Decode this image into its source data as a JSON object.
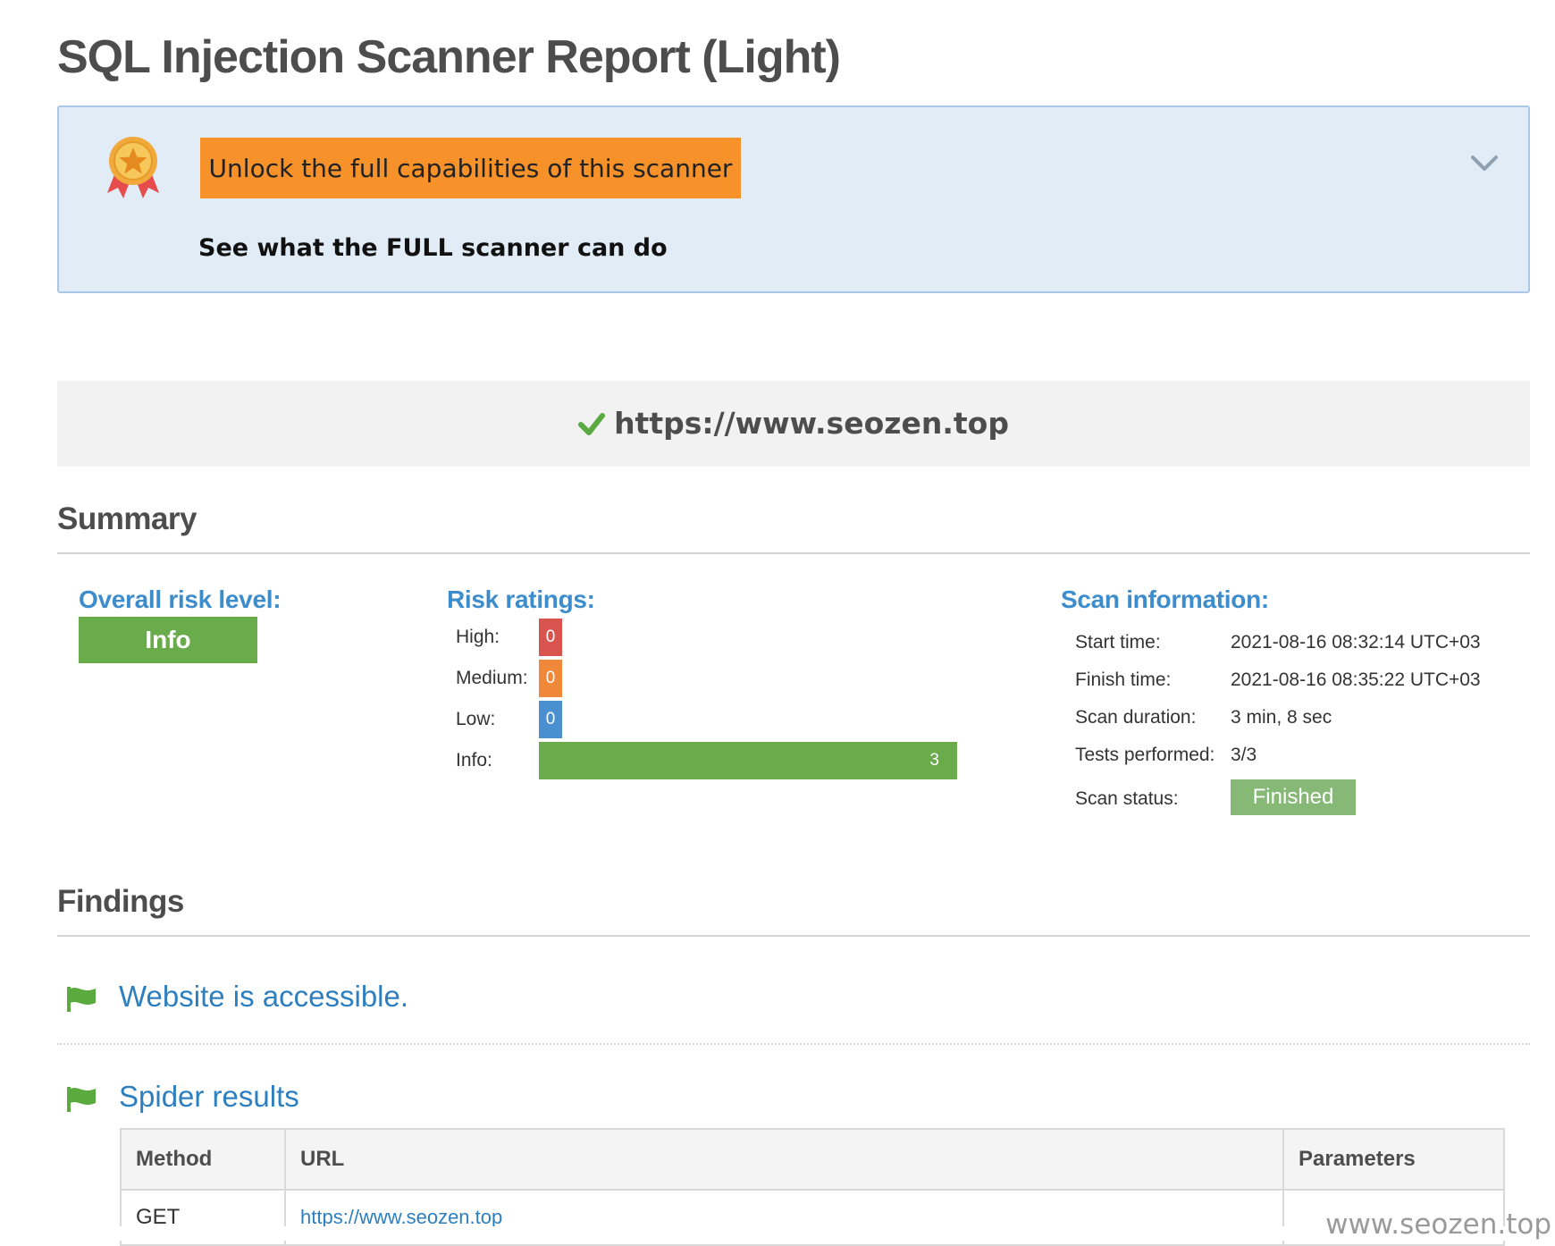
{
  "header": {
    "title": "SQL Injection Scanner Report (Light)"
  },
  "promo": {
    "medal_icon": "medal-icon",
    "button_label": "Unlock the full capabilities of this scanner",
    "subtitle": "See what the FULL scanner can do",
    "toggle_icon": "chevron-down-icon",
    "colors": {
      "background": "#e1ecf6",
      "button": "#f7922a"
    }
  },
  "target": {
    "status_icon": "checkmark-icon",
    "url": "https://www.seozen.top"
  },
  "summary": {
    "title": "Summary",
    "overall_risk": {
      "label": "Overall risk level:",
      "value": "Info",
      "color": "#6aab4c"
    },
    "risk_ratings": {
      "label": "Risk ratings:",
      "items": [
        {
          "name": "High:",
          "count": "0",
          "color": "#d9534f"
        },
        {
          "name": "Medium:",
          "count": "0",
          "color": "#f0883a"
        },
        {
          "name": "Low:",
          "count": "0",
          "color": "#4a8fd0"
        },
        {
          "name": "Info:",
          "count": "3",
          "color": "#6aab4c"
        }
      ]
    },
    "scan_info": {
      "label": "Scan information:",
      "start_time_label": "Start time:",
      "start_time": "2021-08-16 08:32:14 UTC+03",
      "finish_time_label": "Finish time:",
      "finish_time": "2021-08-16 08:35:22 UTC+03",
      "duration_label": "Scan duration:",
      "duration": "3 min, 8 sec",
      "tests_label": "Tests performed:",
      "tests": "3/3",
      "status_label": "Scan status:",
      "status": "Finished",
      "status_color": "#86b975"
    }
  },
  "findings": {
    "title": "Findings",
    "flag_icon": "flag-icon",
    "items": [
      {
        "title": "Website is accessible."
      },
      {
        "title": "Spider results"
      }
    ],
    "spider_table": {
      "columns": [
        "Method",
        "URL",
        "Parameters"
      ],
      "rows": [
        {
          "method": "GET",
          "url": "https://www.seozen.top",
          "parameters": ""
        }
      ]
    }
  },
  "watermark": "www.seozen.top"
}
